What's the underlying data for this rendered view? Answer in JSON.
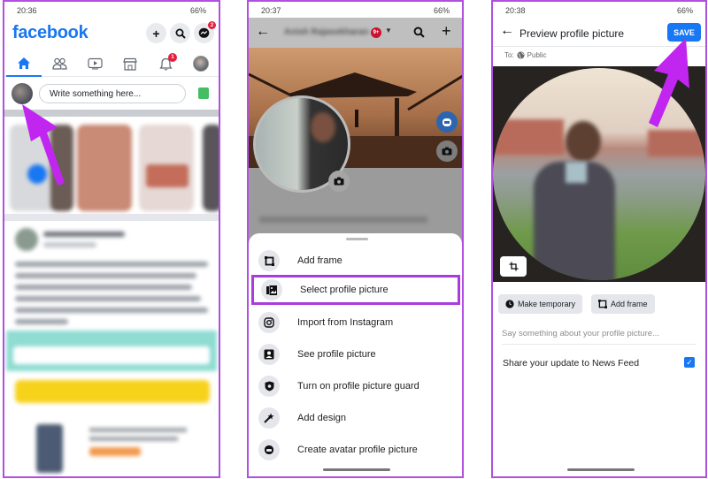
{
  "accent_color": "#1877f2",
  "annotation_color": "#b14fe0",
  "panels": [
    {
      "status": {
        "time": "20:36",
        "battery": "66%"
      },
      "header": {
        "logo": "facebook",
        "actions": [
          {
            "icon": "plus-icon",
            "glyph": "+"
          },
          {
            "icon": "search-icon",
            "glyph": "⚲"
          },
          {
            "icon": "messenger-icon",
            "glyph": "",
            "badge": "2"
          }
        ]
      },
      "nav_tabs": [
        {
          "icon": "home-icon",
          "active": true
        },
        {
          "icon": "friends-icon"
        },
        {
          "icon": "video-icon"
        },
        {
          "icon": "marketplace-icon"
        },
        {
          "icon": "notifications-icon",
          "badge": "1"
        },
        {
          "icon": "profile-menu-icon"
        }
      ],
      "composer": {
        "placeholder": "Write something here..."
      }
    },
    {
      "status": {
        "time": "20:37",
        "battery": "66%"
      },
      "header": {
        "profile_name": "Anish Rajasekharan",
        "badge": "9+"
      },
      "sheet_items": [
        {
          "label": "Add frame",
          "icon": "frame-icon"
        },
        {
          "label": "Select profile picture",
          "icon": "gallery-icon",
          "highlighted": true
        },
        {
          "label": "Import from Instagram",
          "icon": "instagram-icon"
        },
        {
          "label": "See profile picture",
          "icon": "person-icon"
        },
        {
          "label": "Turn on profile picture guard",
          "icon": "shield-icon"
        },
        {
          "label": "Add design",
          "icon": "magic-wand-icon"
        },
        {
          "label": "Create avatar profile picture",
          "icon": "avatar-icon"
        }
      ]
    },
    {
      "status": {
        "time": "20:38",
        "battery": "66%"
      },
      "header": {
        "title": "Preview profile picture",
        "save_label": "SAVE"
      },
      "audience": {
        "prefix": "To:",
        "value": "Public"
      },
      "buttons": {
        "make_temporary": "Make temporary",
        "add_frame": "Add frame"
      },
      "caption_placeholder": "Say something about your profile picture...",
      "share_to_feed": {
        "label": "Share your update to News Feed",
        "checked": true
      }
    }
  ]
}
